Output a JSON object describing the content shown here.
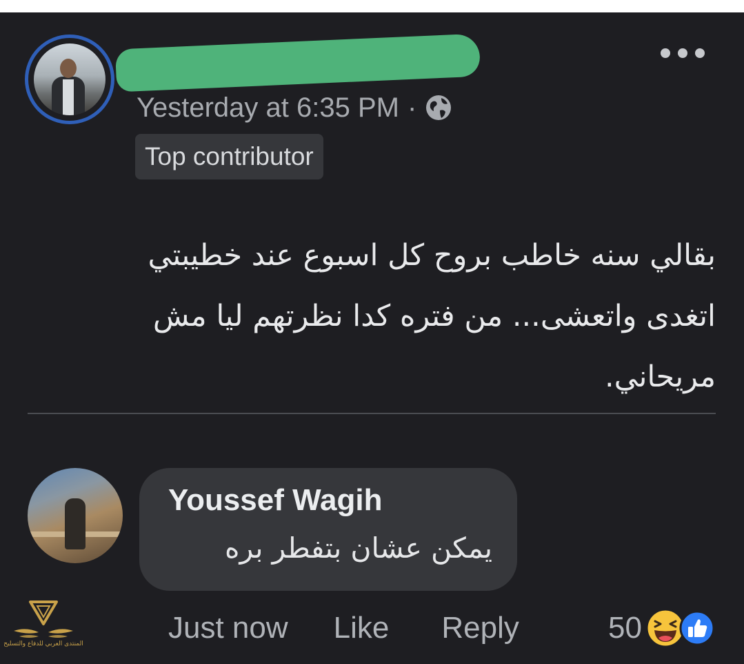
{
  "post": {
    "author_name_redacted": true,
    "timestamp": "Yesterday at 6:35 PM",
    "separator": "·",
    "privacy_icon": "globe-icon",
    "badge": "Top contributor",
    "more_icon": "more-horizontal-icon",
    "body_lines": [
      "بقالي سنه خاطب بروح كل اسبوع عند خطيبتي",
      "اتغدى واتعشى... من فتره كدا نظرتهم ليا مش",
      "مريحاني."
    ]
  },
  "comment": {
    "author": "Youssef Wagih",
    "text": "يمكن عشان بتفطر بره",
    "time": "Just now",
    "like_label": "Like",
    "reply_label": "Reply",
    "reaction_count": "50",
    "reaction_icons": [
      "haha-emoji-icon",
      "like-reaction-icon"
    ]
  },
  "watermark": {
    "text": "المنتدى العربي للدفاع والتسليح"
  },
  "colors": {
    "background": "#1e1e22",
    "bubble": "#36373b",
    "redaction": "#4fb37a",
    "avatar_ring": "#2f5fb8",
    "like_blue": "#2d7cf6",
    "haha_yellow": "#f7c43c"
  }
}
